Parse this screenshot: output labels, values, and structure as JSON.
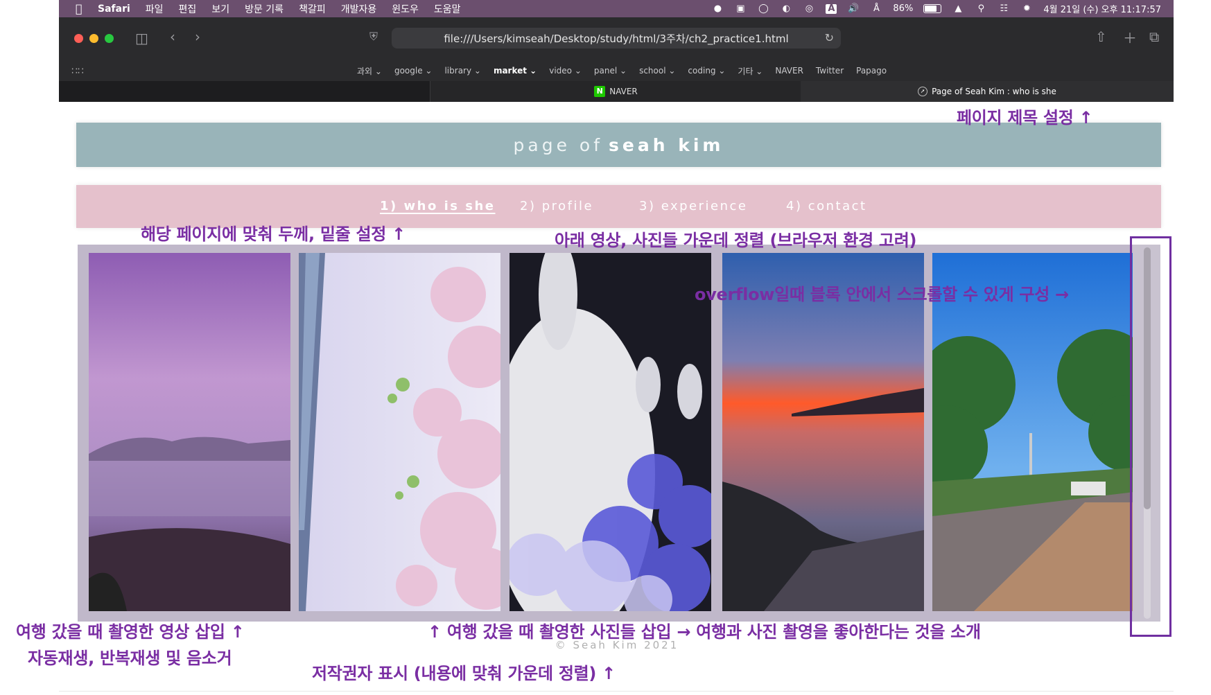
{
  "menubar": {
    "app": "Safari",
    "items": [
      "파일",
      "편집",
      "보기",
      "방문 기록",
      "책갈피",
      "개발자용",
      "윈도우",
      "도움말"
    ],
    "battery": "86%",
    "datetime": "4월 21일 (수) 오후 11:17:57",
    "input_badge": "A"
  },
  "browser": {
    "url": "file:///Users/kimseah/Desktop/study/html/3주차/ch2_practice1.html",
    "bookmarks": [
      "과외 ⌄",
      "google ⌄",
      "library ⌄",
      "market ⌄",
      "video ⌄",
      "panel ⌄",
      "school ⌄",
      "coding ⌄",
      "기타 ⌄",
      "NAVER",
      "Twitter",
      "Papago"
    ],
    "tabs": {
      "middle": "NAVER",
      "active": "Page of Seah Kim : who is she"
    }
  },
  "page": {
    "header": {
      "light": "page of",
      "bold": "seah kim"
    },
    "nav": [
      "1) who is she",
      "2) profile",
      "3) experience",
      "4) contact"
    ],
    "copyright": "© Seah Kim 2021"
  },
  "annotations": {
    "title": "페이지 제목 설정 ↑",
    "nav_style": "해당 페이지에 맞춰 두께, 밑줄 설정 ↑",
    "center": "아래 영상, 사진들 가운데 정렬 (브라우저 환경 고려)",
    "overflow": "overflow일때 블록 안에서 스크롤할 수 있게 구성 →",
    "video_line1": "여행 갔을 때 촬영한 영상 삽입 ↑",
    "video_line2": "자동재생, 반복재생 및 음소거",
    "photos": "↑ 여행 갔을 때 촬영한 사진들 삽입 → 여행과 사진 촬영을 좋아한다는 것을 소개",
    "copyright_note": "저작권자 표시 (내용에 맞춰 가운데 정렬) ↑"
  },
  "colors": {
    "header_bg": "#99b4b9",
    "nav_bg": "#e5c1cc",
    "gallery_bg": "#c0b8ca",
    "annotation": "#7a2ea3"
  }
}
